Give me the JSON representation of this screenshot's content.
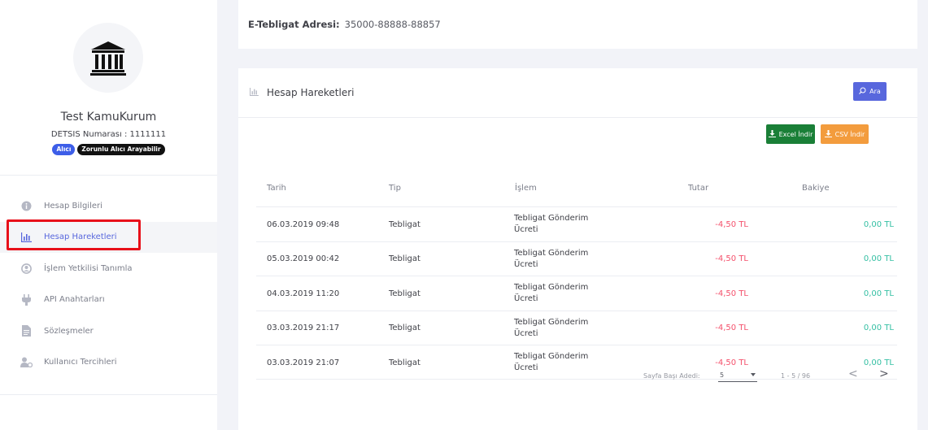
{
  "sidebar": {
    "org_name": "Test KamuKurum",
    "detsis": "DETSIS Numarası : 1111111",
    "badges": [
      "Alıcı",
      "Zorunlu Alıcı Arayabilir"
    ],
    "items": [
      {
        "label": "Hesap Bilgileri",
        "icon": "info-circle-icon",
        "active": false
      },
      {
        "label": "Hesap Hareketleri",
        "icon": "bar-chart-icon",
        "active": true
      },
      {
        "label": "İşlem Yetkilisi Tanımla",
        "icon": "user-circle-icon",
        "active": false
      },
      {
        "label": "API Anahtarları",
        "icon": "plug-icon",
        "active": false
      },
      {
        "label": "Sözleşmeler",
        "icon": "document-icon",
        "active": false
      },
      {
        "label": "Kullanıcı Tercihleri",
        "icon": "user-settings-icon",
        "active": false
      }
    ]
  },
  "address": {
    "label": "E-Tebligat Adresi:",
    "value": "35000-88888-88857"
  },
  "panel": {
    "title": "Hesap Hareketleri",
    "search_label": "Ara",
    "excel_label": "Excel İndir",
    "csv_label": "CSV İndir"
  },
  "table": {
    "headers": [
      "Tarih",
      "Tip",
      "İşlem",
      "Tutar",
      "Bakiye"
    ],
    "rows": [
      {
        "tarih": "06.03.2019 09:48",
        "tip": "Tebligat",
        "islem1": "Tebligat Gönderim",
        "islem2": "Ücreti",
        "tutar": "-4,50 TL",
        "bakiye": "0,00 TL"
      },
      {
        "tarih": "05.03.2019 00:42",
        "tip": "Tebligat",
        "islem1": "Tebligat Gönderim",
        "islem2": "Ücreti",
        "tutar": "-4,50 TL",
        "bakiye": "0,00 TL"
      },
      {
        "tarih": "04.03.2019 11:20",
        "tip": "Tebligat",
        "islem1": "Tebligat Gönderim",
        "islem2": "Ücreti",
        "tutar": "-4,50 TL",
        "bakiye": "0,00 TL"
      },
      {
        "tarih": "03.03.2019 21:17",
        "tip": "Tebligat",
        "islem1": "Tebligat Gönderim",
        "islem2": "Ücreti",
        "tutar": "-4,50 TL",
        "bakiye": "0,00 TL"
      },
      {
        "tarih": "03.03.2019 21:07",
        "tip": "Tebligat",
        "islem1": "Tebligat Gönderim",
        "islem2": "Ücreti",
        "tutar": "-4,50 TL",
        "bakiye": "0,00 TL"
      }
    ]
  },
  "pagination": {
    "page_size_label": "Sayfa Başı Adedi:",
    "page_size": "5",
    "range": "1 - 5 / 96",
    "prev": "<",
    "next": ">"
  },
  "colors": {
    "accent": "#5867dd",
    "negative": "#f4516c",
    "positive": "#34bfa3",
    "excel": "#1a7f37",
    "csv": "#f39c3d",
    "highlight": "#e8101a"
  }
}
